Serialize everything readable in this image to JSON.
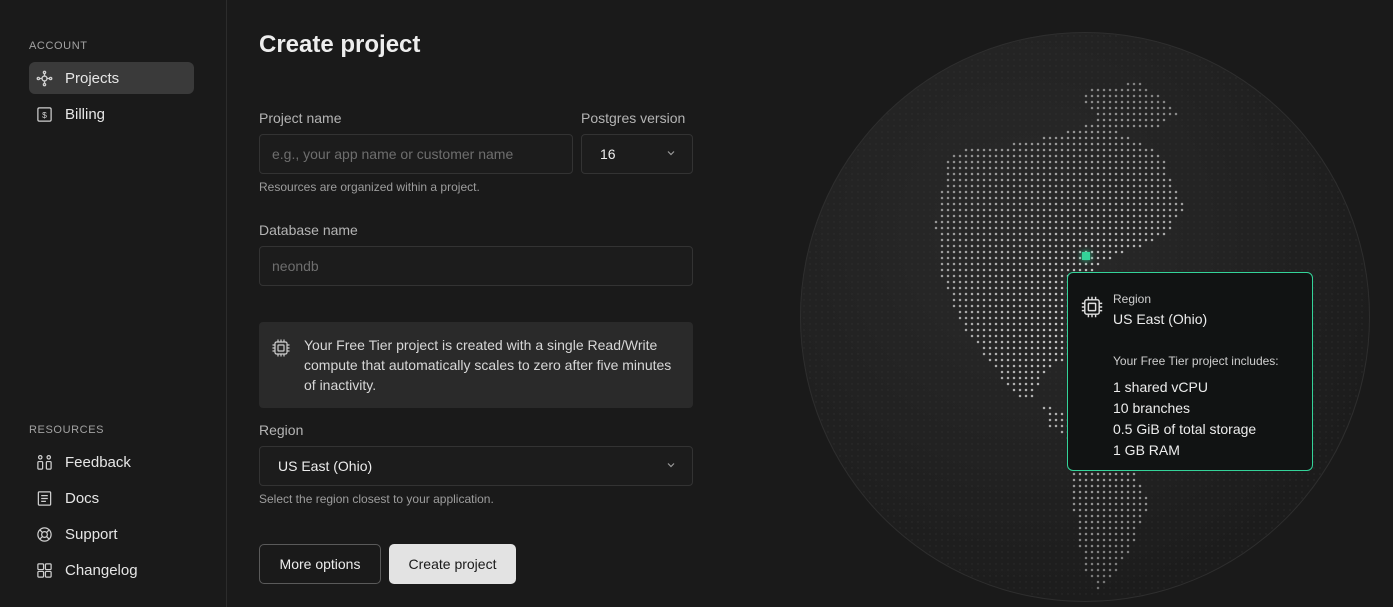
{
  "sidebar": {
    "account_label": "ACCOUNT",
    "account_items": [
      {
        "label": "Projects",
        "icon": "projects-icon",
        "active": true
      },
      {
        "label": "Billing",
        "icon": "billing-icon",
        "active": false
      }
    ],
    "resources_label": "RESOURCES",
    "resource_items": [
      {
        "label": "Feedback",
        "icon": "feedback-icon"
      },
      {
        "label": "Docs",
        "icon": "docs-icon"
      },
      {
        "label": "Support",
        "icon": "support-icon"
      },
      {
        "label": "Changelog",
        "icon": "changelog-icon"
      }
    ]
  },
  "form": {
    "title": "Create project",
    "project_name": {
      "label": "Project name",
      "placeholder": "e.g., your app name or customer name",
      "value": "",
      "hint": "Resources are organized within a project."
    },
    "postgres_version": {
      "label": "Postgres version",
      "value": "16"
    },
    "database_name": {
      "label": "Database name",
      "placeholder": "neondb",
      "value": ""
    },
    "info": "Your Free Tier project is created with a single Read/Write compute that automatically scales to zero after five minutes of inactivity.",
    "region": {
      "label": "Region",
      "value": "US East (Ohio)",
      "hint": "Select the region closest to your application."
    },
    "more_options_label": "More options",
    "create_label": "Create project"
  },
  "tooltip": {
    "label": "Region",
    "region": "US East (Ohio)",
    "includes_label": "Your Free Tier project includes:",
    "items": [
      "1 shared vCPU",
      "10 branches",
      "0.5 GiB of total storage",
      "1 GB RAM"
    ]
  },
  "colors": {
    "accent": "#34d399",
    "background": "#1a1a1a",
    "active_nav": "#3a3a3a"
  }
}
